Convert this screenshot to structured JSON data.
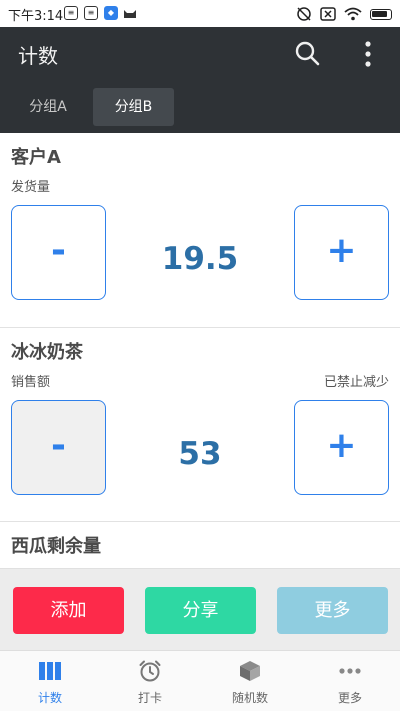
{
  "status_bar": {
    "time": "下午3:14"
  },
  "app_bar": {
    "title": "计数"
  },
  "tabs": [
    {
      "label": "分组A",
      "active": false
    },
    {
      "label": "分组B",
      "active": true
    }
  ],
  "counters": [
    {
      "title": "客户A",
      "subtitle": "发货量",
      "note": "",
      "value": "19.5",
      "minus_label": "-",
      "plus_label": "+",
      "minus_disabled": false
    },
    {
      "title": "冰冰奶茶",
      "subtitle": "销售额",
      "note": "已禁止减少",
      "value": "53",
      "minus_label": "-",
      "plus_label": "+",
      "minus_disabled": true
    },
    {
      "title": "西瓜剩余量"
    }
  ],
  "actions": {
    "add": "添加",
    "share": "分享",
    "more": "更多"
  },
  "bottom_nav": [
    {
      "label": "计数",
      "icon": "bar-columns-icon",
      "active": true
    },
    {
      "label": "打卡",
      "icon": "alarm-clock-icon",
      "active": false
    },
    {
      "label": "随机数",
      "icon": "dice-cube-icon",
      "active": false
    },
    {
      "label": "更多",
      "icon": "ellipsis-icon",
      "active": false
    }
  ],
  "colors": {
    "accent": "#2f80ea",
    "value_text": "#2c6fa6",
    "app_bar": "#2e3236",
    "add_button": "#fd2a4a",
    "share_button": "#2ed8a3",
    "more_button": "#8fcde0"
  }
}
